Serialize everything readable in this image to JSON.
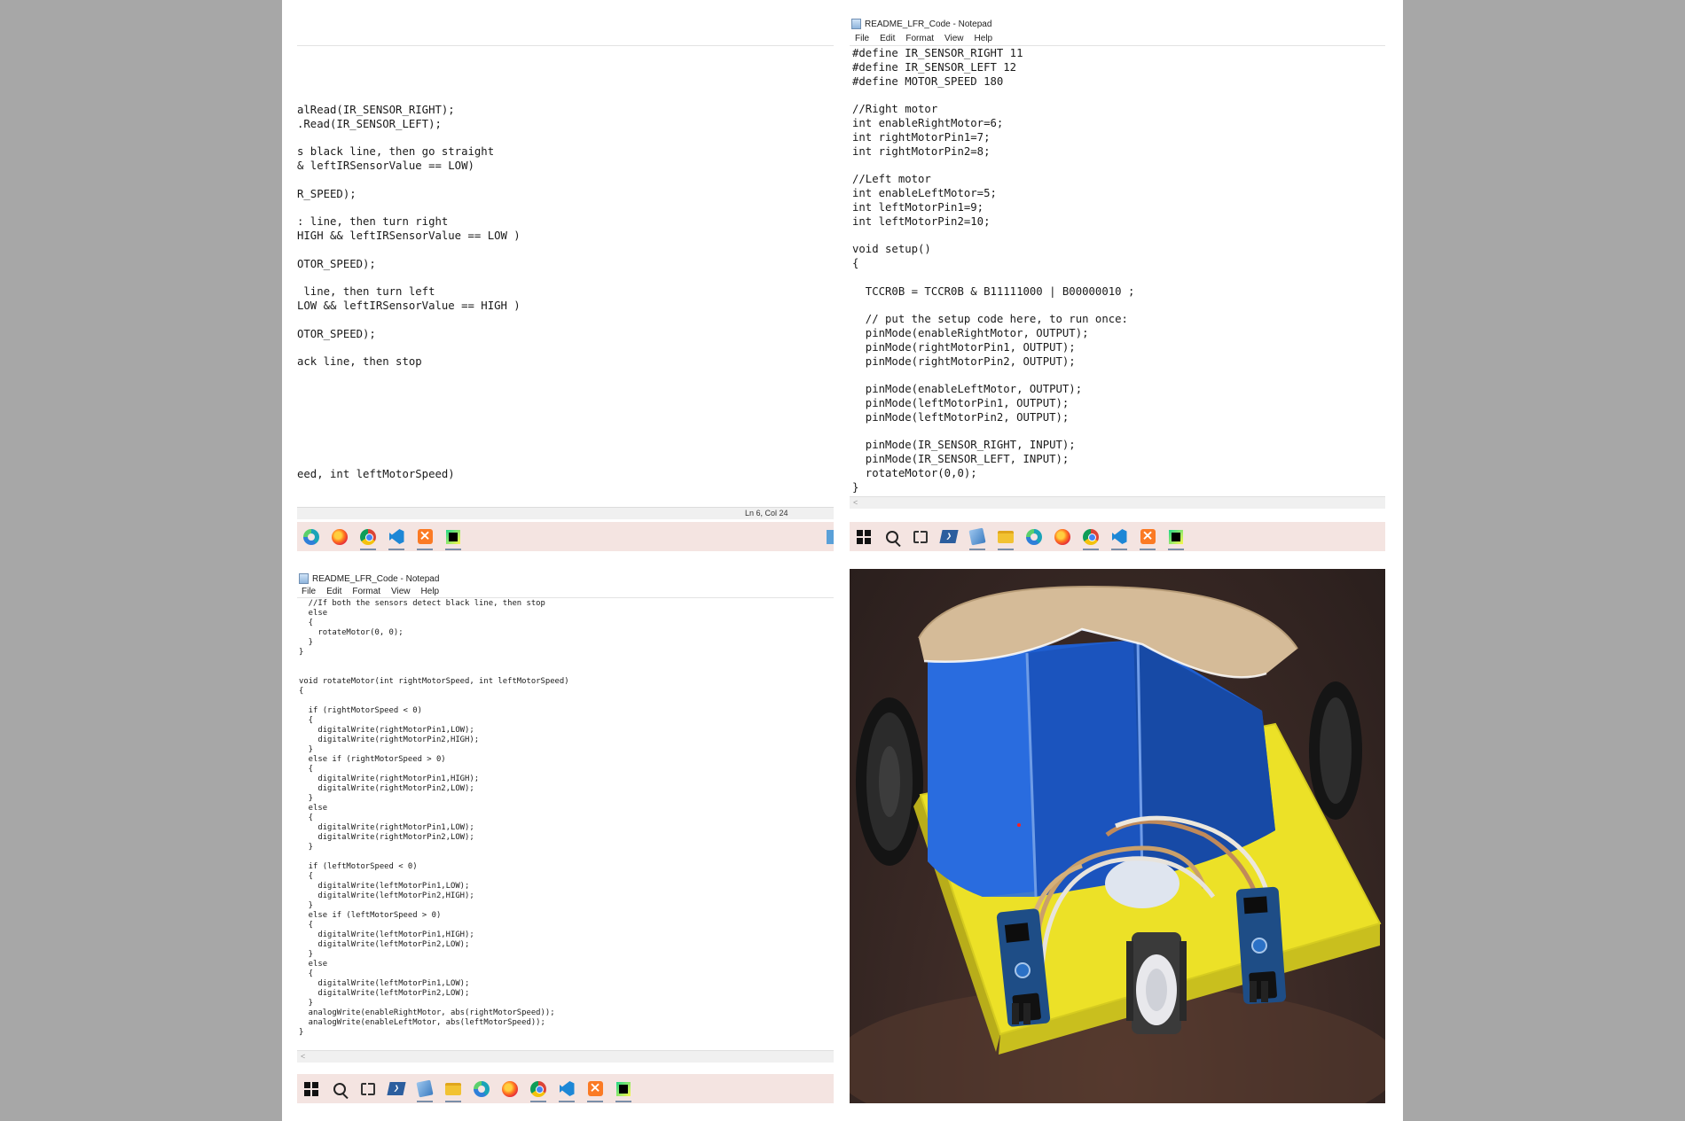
{
  "notepad": {
    "window_title": "README_LFR_Code - Notepad",
    "menu": [
      "File",
      "Edit",
      "Format",
      "View",
      "Help"
    ]
  },
  "panel1": {
    "code": "alRead(IR_SENSOR_RIGHT);\n.Read(IR_SENSOR_LEFT);\n\ns black line, then go straight\n& leftIRSensorValue == LOW)\n\nR_SPEED);\n\n: line, then turn right\nHIGH && leftIRSensorValue == LOW )\n\nOTOR_SPEED);\n\n line, then turn left\nLOW && leftIRSensorValue == HIGH )\n\nOTOR_SPEED);\n\nack line, then stop\n\n\n\n\n\n\n\need, int leftMotorSpeed)",
    "status_position": "Ln 6, Col 24"
  },
  "panel2": {
    "code": "#define IR_SENSOR_RIGHT 11\n#define IR_SENSOR_LEFT 12\n#define MOTOR_SPEED 180\n\n//Right motor\nint enableRightMotor=6;\nint rightMotorPin1=7;\nint rightMotorPin2=8;\n\n//Left motor\nint enableLeftMotor=5;\nint leftMotorPin1=9;\nint leftMotorPin2=10;\n\nvoid setup()\n{\n\n  TCCR0B = TCCR0B & B11111000 | B00000010 ;\n\n  // put the setup code here, to run once:\n  pinMode(enableRightMotor, OUTPUT);\n  pinMode(rightMotorPin1, OUTPUT);\n  pinMode(rightMotorPin2, OUTPUT);\n\n  pinMode(enableLeftMotor, OUTPUT);\n  pinMode(leftMotorPin1, OUTPUT);\n  pinMode(leftMotorPin2, OUTPUT);\n\n  pinMode(IR_SENSOR_RIGHT, INPUT);\n  pinMode(IR_SENSOR_LEFT, INPUT);\n  rotateMotor(0,0);\n}"
  },
  "panel3": {
    "code": "  //If both the sensors detect black line, then stop\n  else\n  {\n    rotateMotor(0, 0);\n  }\n}\n\n\nvoid rotateMotor(int rightMotorSpeed, int leftMotorSpeed)\n{\n\n  if (rightMotorSpeed < 0)\n  {\n    digitalWrite(rightMotorPin1,LOW);\n    digitalWrite(rightMotorPin2,HIGH);\n  }\n  else if (rightMotorSpeed > 0)\n  {\n    digitalWrite(rightMotorPin1,HIGH);\n    digitalWrite(rightMotorPin2,LOW);\n  }\n  else\n  {\n    digitalWrite(rightMotorPin1,LOW);\n    digitalWrite(rightMotorPin2,LOW);\n  }\n\n  if (leftMotorSpeed < 0)\n  {\n    digitalWrite(leftMotorPin1,LOW);\n    digitalWrite(leftMotorPin2,HIGH);\n  }\n  else if (leftMotorSpeed > 0)\n  {\n    digitalWrite(leftMotorPin1,HIGH);\n    digitalWrite(leftMotorPin2,LOW);\n  }\n  else\n  {\n    digitalWrite(leftMotorPin1,LOW);\n    digitalWrite(leftMotorPin2,LOW);\n  }\n  analogWrite(enableRightMotor, abs(rightMotorSpeed));\n  analogWrite(enableLeftMotor, abs(leftMotorSpeed));\n}"
  },
  "scroll_left_glyph": "<",
  "taskbar": {
    "background": "#f4e4e1",
    "full_icons": [
      "windows-start-icon",
      "search-icon",
      "task-view-icon",
      "powershell-icon",
      "notepad-icon",
      "file-explorer-icon",
      "edge-icon",
      "firefox-icon",
      "chrome-icon",
      "vscode-icon",
      "xampp-icon",
      "pycharm-icon"
    ],
    "partial_icons": [
      "edge-icon",
      "firefox-icon",
      "chrome-icon",
      "vscode-icon",
      "xampp-icon",
      "pycharm-icon"
    ]
  },
  "photo": {
    "subject": "line follower robot",
    "colors": {
      "body": "#1f5fd0",
      "base": "#f2ea2a",
      "lid": "#d4b896",
      "wheel": "#1a1a1a",
      "sensor_board": "#1f4f86"
    }
  }
}
